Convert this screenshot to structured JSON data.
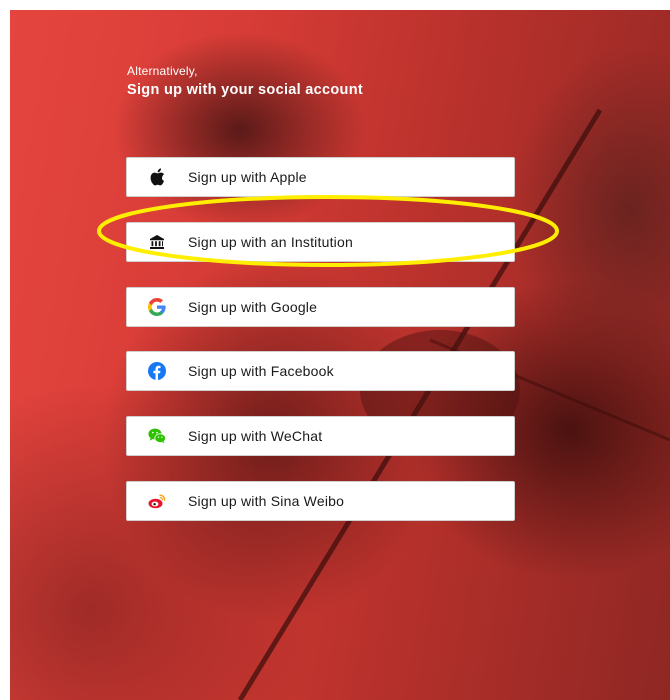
{
  "intro": {
    "small": "Alternatively,",
    "large": "Sign up with your social account"
  },
  "buttons": [
    {
      "label": "Sign up with Apple",
      "icon": "apple-icon"
    },
    {
      "label": "Sign up with an Institution",
      "icon": "institution-icon"
    },
    {
      "label": "Sign up with Google",
      "icon": "google-icon"
    },
    {
      "label": "Sign up with Facebook",
      "icon": "facebook-icon"
    },
    {
      "label": "Sign up with WeChat",
      "icon": "wechat-icon"
    },
    {
      "label": "Sign up with Sina Weibo",
      "icon": "sina-weibo-icon"
    }
  ],
  "colors": {
    "background_red": "#d83c36",
    "highlight_ellipse": "#ffee00",
    "facebook_blue": "#1877f2",
    "wechat_green": "#2dc100",
    "weibo_red": "#e6162d"
  }
}
